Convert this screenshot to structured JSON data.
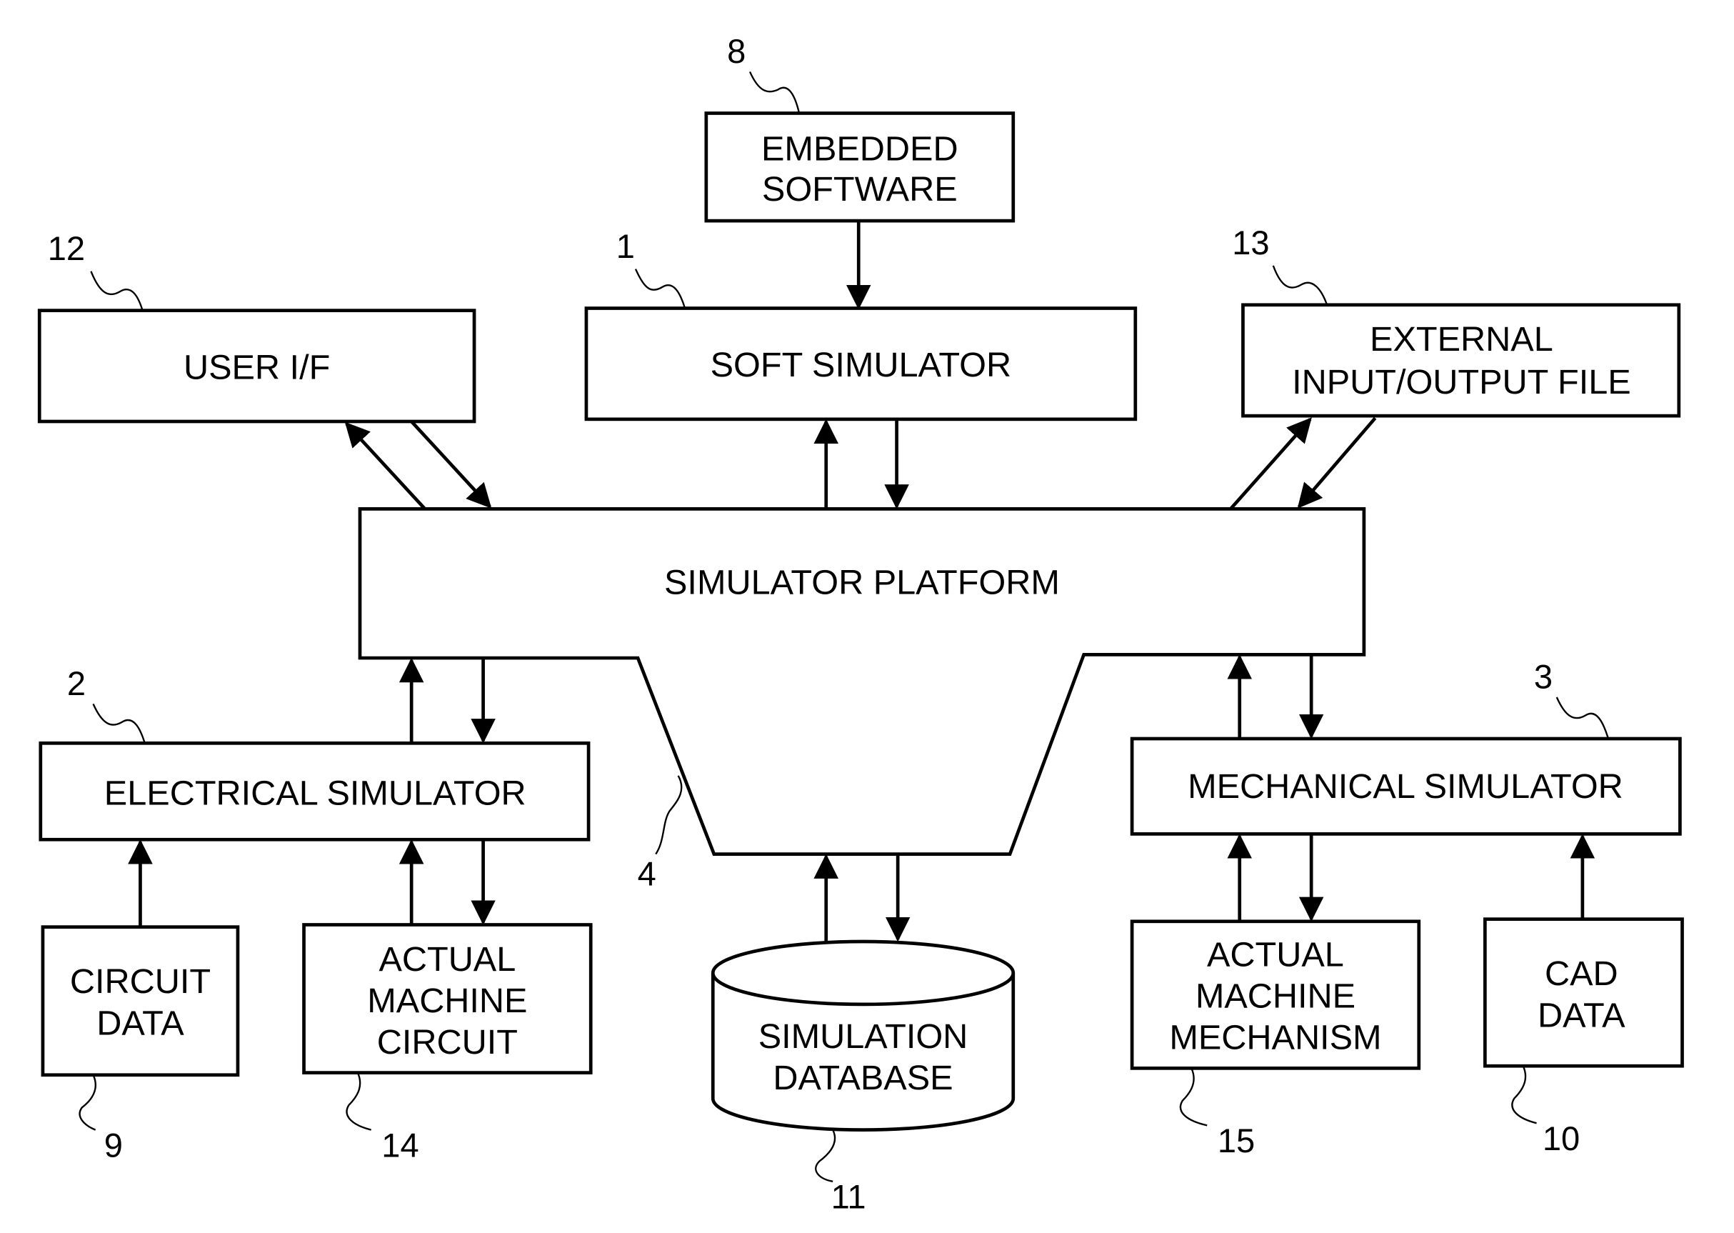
{
  "diagram": {
    "blocks": {
      "embedded_software": {
        "ref": "8",
        "lines": [
          "EMBEDDED",
          "SOFTWARE"
        ]
      },
      "soft_simulator": {
        "ref": "1",
        "lines": [
          "SOFT SIMULATOR"
        ]
      },
      "user_if": {
        "ref": "12",
        "lines": [
          "USER I/F"
        ]
      },
      "external_io_file": {
        "ref": "13",
        "lines": [
          "EXTERNAL",
          "INPUT/OUTPUT FILE"
        ]
      },
      "simulator_platform": {
        "ref": "4",
        "lines": [
          "SIMULATOR PLATFORM"
        ]
      },
      "electrical_simulator": {
        "ref": "2",
        "lines": [
          "ELECTRICAL SIMULATOR"
        ]
      },
      "mechanical_simulator": {
        "ref": "3",
        "lines": [
          "MECHANICAL SIMULATOR"
        ]
      },
      "circuit_data": {
        "ref": "9",
        "lines": [
          "CIRCUIT",
          "DATA"
        ]
      },
      "actual_machine_circuit": {
        "ref": "14",
        "lines": [
          "ACTUAL",
          "MACHINE",
          "CIRCUIT"
        ]
      },
      "simulation_database": {
        "ref": "11",
        "lines": [
          "SIMULATION",
          "DATABASE"
        ]
      },
      "actual_machine_mechanism": {
        "ref": "15",
        "lines": [
          "ACTUAL",
          "MACHINE",
          "MECHANISM"
        ]
      },
      "cad_data": {
        "ref": "10",
        "lines": [
          "CAD",
          "DATA"
        ]
      }
    },
    "connections": [
      {
        "from": "embedded_software",
        "to": "soft_simulator"
      },
      {
        "from": "simulator_platform",
        "to": "soft_simulator"
      },
      {
        "from": "soft_simulator",
        "to": "simulator_platform"
      },
      {
        "from": "simulator_platform",
        "to": "user_if"
      },
      {
        "from": "user_if",
        "to": "simulator_platform"
      },
      {
        "from": "simulator_platform",
        "to": "external_io_file"
      },
      {
        "from": "external_io_file",
        "to": "simulator_platform"
      },
      {
        "from": "electrical_simulator",
        "to": "simulator_platform"
      },
      {
        "from": "simulator_platform",
        "to": "electrical_simulator"
      },
      {
        "from": "mechanical_simulator",
        "to": "simulator_platform"
      },
      {
        "from": "simulator_platform",
        "to": "mechanical_simulator"
      },
      {
        "from": "simulation_database",
        "to": "simulator_platform"
      },
      {
        "from": "simulator_platform",
        "to": "simulation_database"
      },
      {
        "from": "circuit_data",
        "to": "electrical_simulator"
      },
      {
        "from": "actual_machine_circuit",
        "to": "electrical_simulator"
      },
      {
        "from": "electrical_simulator",
        "to": "actual_machine_circuit"
      },
      {
        "from": "actual_machine_mechanism",
        "to": "mechanical_simulator"
      },
      {
        "from": "mechanical_simulator",
        "to": "actual_machine_mechanism"
      },
      {
        "from": "cad_data",
        "to": "mechanical_simulator"
      }
    ]
  }
}
